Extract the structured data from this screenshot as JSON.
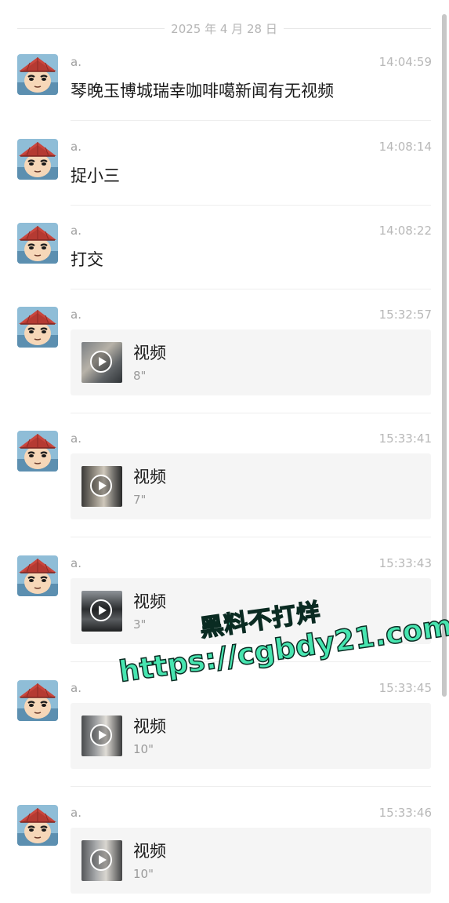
{
  "date_divider": "2025 年 4 月 28 日",
  "messages": [
    {
      "sender": "a.",
      "time": "14:04:59",
      "type": "text",
      "text": "琴晚玉博城瑞幸咖啡噶新闻有无视频"
    },
    {
      "sender": "a.",
      "time": "14:08:14",
      "type": "text",
      "text": "捉小三"
    },
    {
      "sender": "a.",
      "time": "14:08:22",
      "type": "text",
      "text": "打交"
    },
    {
      "sender": "a.",
      "time": "15:32:57",
      "type": "video",
      "title": "视频",
      "duration": "8\""
    },
    {
      "sender": "a.",
      "time": "15:33:41",
      "type": "video",
      "title": "视频",
      "duration": "7\""
    },
    {
      "sender": "a.",
      "time": "15:33:43",
      "type": "video",
      "title": "视频",
      "duration": "3\""
    },
    {
      "sender": "a.",
      "time": "15:33:45",
      "type": "video",
      "title": "视频",
      "duration": "10\""
    },
    {
      "sender": "a.",
      "time": "15:33:46",
      "type": "video",
      "title": "视频",
      "duration": "10\""
    }
  ],
  "watermark": {
    "line1": "黑料不打烊",
    "line2": "https://cgbdy21.com",
    "color": "#47e5b0"
  },
  "icons": {
    "avatar": "cartoon-boy-with-straw-hat",
    "play": "play-icon"
  }
}
